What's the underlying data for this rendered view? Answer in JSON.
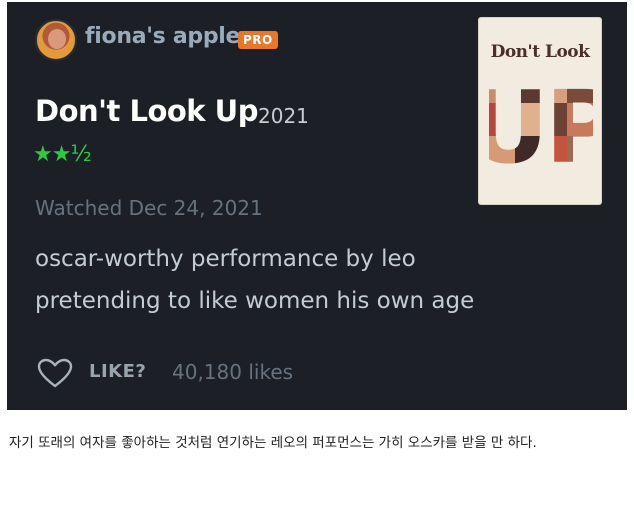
{
  "review_card": {
    "username": "fiona's apple",
    "badge": "PRO",
    "film_title": "Don't Look Up",
    "film_year": "2021",
    "rating": "★★½",
    "watched_date": "Watched Dec 24, 2021",
    "review_text": "oscar-worthy performance by leo pretending to like women his own age",
    "poster_title": "Don't Look",
    "poster_big_text": "UP",
    "like_label": "LIKE?",
    "likes_count": "40,180 likes"
  },
  "caption": "자기 또래의 여자를 좋아하는 것처럼 연기하는 레오의 퍼포먼스는 가히 오스카를 받을 만 하다.",
  "colors": {
    "card_bg": "#1c2026",
    "star_green": "#2dc93e",
    "pro_orange": "#e8762b"
  }
}
